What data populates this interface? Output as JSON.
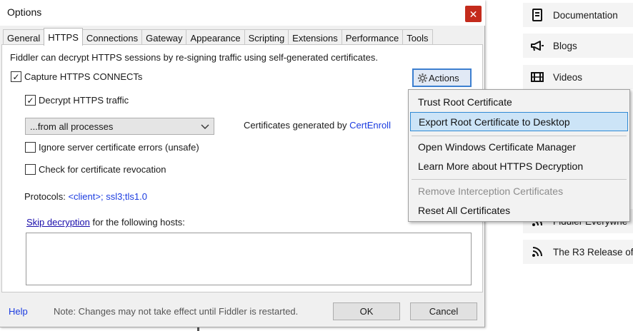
{
  "background": {
    "items": [
      {
        "icon": "document-icon",
        "label": "Documentation"
      },
      {
        "icon": "megaphone-icon",
        "label": "Blogs"
      },
      {
        "icon": "film-icon",
        "label": "Videos"
      },
      {
        "icon": "rss-icon",
        "label": "Fiddler Everywhe"
      },
      {
        "icon": "rss-icon",
        "label": "The R3 Release of"
      }
    ],
    "fragment_i": "i"
  },
  "dialog": {
    "title": "Options",
    "close_glyph": "✕",
    "tabs": [
      "General",
      "HTTPS",
      "Connections",
      "Gateway",
      "Appearance",
      "Scripting",
      "Extensions",
      "Performance",
      "Tools"
    ],
    "active_tab": "HTTPS",
    "https": {
      "intro": "Fiddler can decrypt HTTPS sessions by re-signing traffic using self-generated certificates.",
      "capture_label": "Capture HTTPS CONNECTs",
      "capture_checked": true,
      "actions_label": "Actions",
      "decrypt_label": "Decrypt HTTPS traffic",
      "decrypt_checked": true,
      "process_filter": "...from all processes",
      "certs_generated_prefix": "Certificates generated by",
      "certs_generated_engine": "CertEnroll",
      "ignore_errors_label": "Ignore server certificate errors (unsafe)",
      "ignore_errors_checked": false,
      "revocation_label": "Check for certificate revocation",
      "revocation_checked": false,
      "protocols_prefix": "Protocols:",
      "protocols_value": "<client>; ssl3;tls1.0",
      "skip_link": "Skip decryption",
      "skip_suffix": "for the following hosts:",
      "hosts_value": ""
    },
    "footer": {
      "help": "Help",
      "note": "Note: Changes may not take effect until Fiddler is restarted.",
      "ok": "OK",
      "cancel": "Cancel"
    }
  },
  "menu": {
    "items": [
      {
        "label": "Trust Root Certificate",
        "state": "normal"
      },
      {
        "label": "Export Root Certificate to Desktop",
        "state": "highlighted"
      },
      {
        "label": "Open Windows Certificate Manager",
        "state": "normal"
      },
      {
        "label": "Learn More about HTTPS Decryption",
        "state": "normal"
      },
      {
        "label": "Remove Interception Certificates",
        "state": "disabled"
      },
      {
        "label": "Reset All Certificates",
        "state": "normal"
      }
    ]
  },
  "colors": {
    "close": "#c42b1c",
    "link": "#1a0dab",
    "menu_highlight": "#cce4f7",
    "menu_highlight_border": "#2f8ad4",
    "actions_border": "#3c7fd0"
  }
}
